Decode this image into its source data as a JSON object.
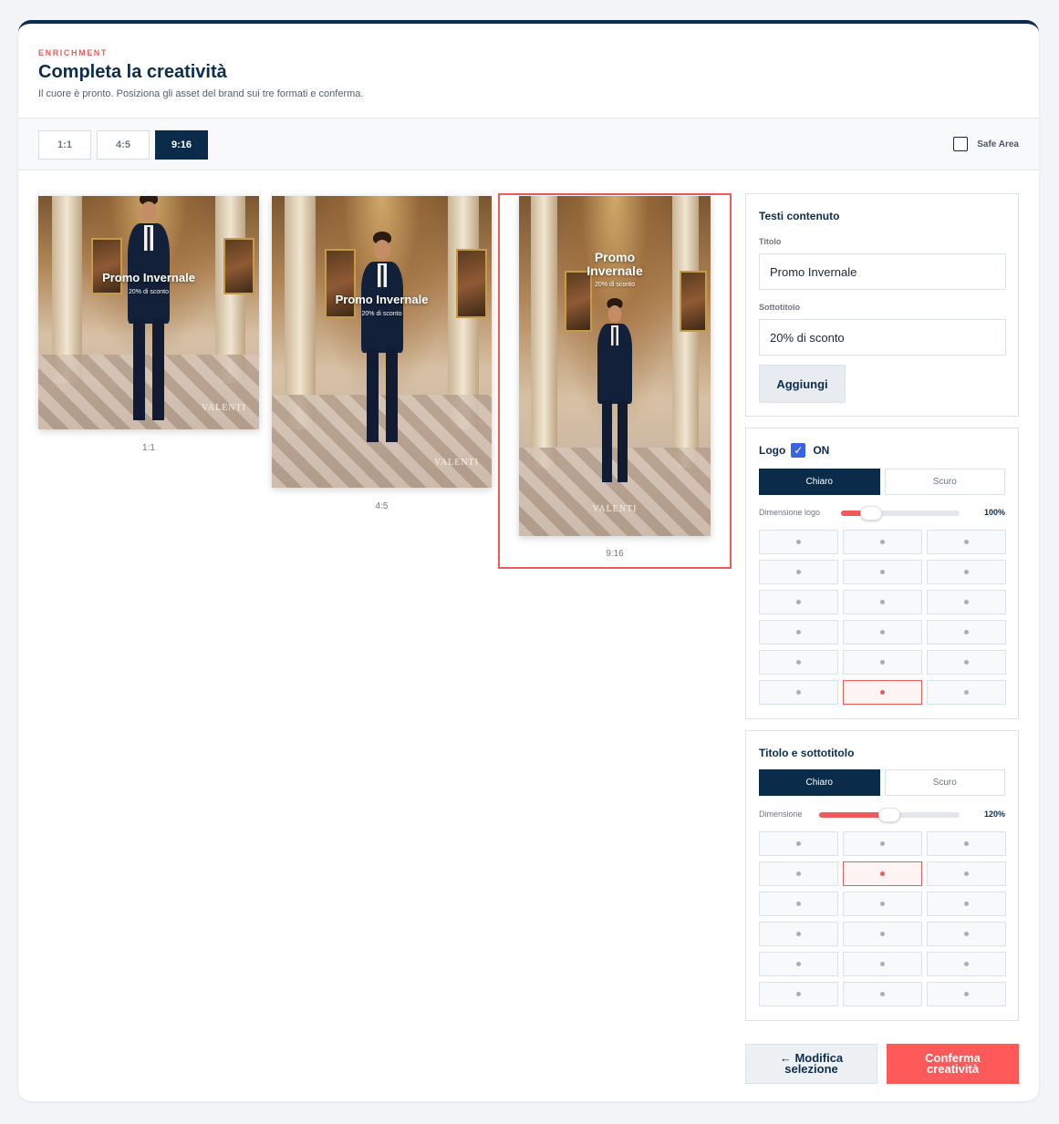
{
  "header": {
    "eyebrow": "ENRICHMENT",
    "title": "Completa la creatività",
    "subtitle": "Il cuore è pronto. Posiziona gli asset del brand sui tre formati e conferma."
  },
  "toolbar": {
    "formats": [
      "1:1",
      "4:5",
      "9:16"
    ],
    "active_format": "9:16",
    "safe_area_label": "Safe Area",
    "safe_area_checked": false
  },
  "previews": [
    {
      "format": "1:1",
      "label": "1:1",
      "overlay_title": "Promo Invernale",
      "overlay_subtitle": "20% di sconto",
      "logo": "VALENTI"
    },
    {
      "format": "4:5",
      "label": "4:5",
      "overlay_title": "Promo Invernale",
      "overlay_subtitle": "20% di sconto",
      "logo": "VALENTI"
    },
    {
      "format": "9:16",
      "label": "9:16",
      "overlay_title": "Promo Invernale",
      "overlay_subtitle": "20% di sconto",
      "logo": "VALENTI",
      "selected": true
    }
  ],
  "content_panel": {
    "title": "Testi contenuto",
    "title_label": "Titolo",
    "title_value": "Promo Invernale",
    "subtitle_label": "Sottotitolo",
    "subtitle_value": "20% di sconto",
    "add_button": "Aggiungi"
  },
  "logo_panel": {
    "title": "Logo",
    "toggle_label": "ON",
    "enabled": true,
    "theme_options": [
      "Chiaro",
      "Scuro"
    ],
    "theme_selected": "Chiaro",
    "size_label": "Dimensione logo",
    "size_value": "100%",
    "size_fraction": 0.25,
    "position_rows": 6,
    "position_cols": 3,
    "position_selected": {
      "row": 5,
      "col": 1
    }
  },
  "text_panel": {
    "title": "Titolo e sottotitolo",
    "theme_options": [
      "Chiaro",
      "Scuro"
    ],
    "theme_selected": "Chiaro",
    "size_label": "Dimensione",
    "size_value": "120%",
    "size_fraction": 0.5,
    "position_rows": 6,
    "position_cols": 3,
    "position_selected": {
      "row": 1,
      "col": 1
    }
  },
  "actions": {
    "back_label_line1": "← Modifica",
    "back_label_line2": "selezione",
    "confirm_label_line1": "Conferma",
    "confirm_label_line2": "creatività"
  },
  "colors": {
    "navy": "#0b2b4a",
    "accent": "#ef5a5a",
    "confirm": "#ff5a5a",
    "checkbox_on": "#3a63e0"
  }
}
